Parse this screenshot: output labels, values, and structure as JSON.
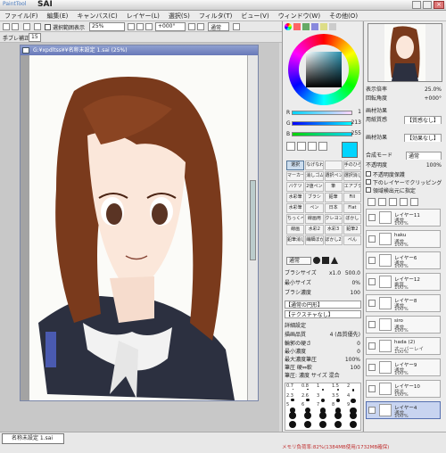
{
  "app": {
    "title": "SAI",
    "brand": "PaintTool"
  },
  "menu": [
    "ファイル(F)",
    "編集(E)",
    "キャンバス(C)",
    "レイヤー(L)",
    "選択(S)",
    "フィルタ(T)",
    "ビュー(V)",
    "ウィンドウ(W)",
    "その他(O)"
  ],
  "toolbar": {
    "selection_label": "選択範囲表示",
    "zoom": "25%",
    "rotation": "+000°",
    "mode": "通常",
    "stabilizer_label": "手ブレ補正",
    "stabilizer_value": "15"
  },
  "canvas": {
    "title": "G:¥xpdltss¥¥名称未設定 1.sai (25%)"
  },
  "bottom_tab": "名称未設定 1.sai",
  "status_text": "メモリ負荷率:82%(1384MB使用/1732MB確保)",
  "color": {
    "r": 1,
    "g": 213,
    "b": 255,
    "r_label": "R",
    "g_label": "G",
    "b_label": "B",
    "hex": "#01d5ff"
  },
  "tools": [
    "選択",
    "なげなわ",
    "",
    "手のひら",
    "マーカー",
    "消しゴム",
    "選択ペン",
    "選択消し",
    "バケツ",
    "2値ペン",
    "筆",
    "エアブラシ",
    "水彩筆",
    "ブラシ",
    "鉛筆",
    "Fill",
    "水彩筆",
    "ペン",
    "日本",
    "Flat",
    "ちっくぺ",
    "線画用",
    "クレヨン",
    "ぼかし",
    "線画",
    "水彩2",
    "水彩3",
    "鉛筆2",
    "鉛筆消し",
    "繊細ぼかし",
    "ぼかし2",
    "ぺん"
  ],
  "brush": {
    "mode": "通常",
    "size_label": "ブラシサイズ",
    "size_mult": "x1.0",
    "size_value": "500.0",
    "min_label": "最小サイズ",
    "min_value": "0%",
    "density_label": "ブラシ濃度",
    "density_value": "100",
    "shape_label": "【通常の円形】",
    "texture_label": "【テクスチャなし】",
    "detail_label": "詳細設定",
    "quality_label": "描画品質",
    "quality_value": "4 (品質優先)",
    "edge_label": "輪郭の硬さ",
    "edge_value": "0",
    "min_density_label": "最小濃度",
    "min_density_value": "0",
    "max_pressure_label": "最大濃度筆圧",
    "max_pressure_value": "100%",
    "pressure_label": "筆圧 硬⇔軟",
    "pressure_value": "100",
    "pressure2_label": "筆圧:",
    "pressure2_a": "濃度",
    "pressure2_b": "サイズ",
    "pressure2_c": "混合"
  },
  "brush_sizes": [
    [
      "0.7",
      "0.8",
      "1",
      "1.5",
      "2"
    ],
    [
      "2.3",
      "2.6",
      "3",
      "3.5",
      "4"
    ],
    [
      "5",
      "6",
      "7",
      "8",
      "9"
    ],
    [
      "10",
      "12",
      "14",
      "16",
      "20"
    ],
    [
      "25",
      "30",
      "35",
      "40",
      "50"
    ]
  ],
  "nav": {
    "zoom_label": "表示倍率",
    "zoom_value": "25.0%",
    "angle_label": "回転角度",
    "angle_value": "+000°",
    "paper_effect_label": "画材効果",
    "paper_texture_label": "用紙質感",
    "paper_texture_value": "【質感なし】",
    "paper_effect_value_label": "画材効果",
    "paper_effect_value": "【効果なし】",
    "blend_label": "合成モード",
    "blend_value": "通常",
    "opacity_label": "不透明度",
    "opacity_value": "100%",
    "protect_label": "不透明度保護",
    "clip_label": "下のレイヤーでクリッピング",
    "select_source_label": "領域検出元に指定"
  },
  "layers": [
    {
      "name": "レイヤー11",
      "mode": "通常",
      "opacity": "100%"
    },
    {
      "name": "haku",
      "mode": "通常",
      "opacity": "100%"
    },
    {
      "name": "レイヤー6",
      "mode": "通常",
      "opacity": "100%"
    },
    {
      "name": "レイヤー12",
      "mode": "乗算",
      "opacity": "100%"
    },
    {
      "name": "レイヤー8",
      "mode": "通常",
      "opacity": "100%"
    },
    {
      "name": "siro",
      "mode": "通常",
      "opacity": "100%"
    },
    {
      "name": "hada (2)",
      "mode": "オーバーレイ",
      "opacity": "100%"
    },
    {
      "name": "レイヤー9",
      "mode": "通常",
      "opacity": "100%"
    },
    {
      "name": "レイヤー10",
      "mode": "発光",
      "opacity": "100%"
    },
    {
      "name": "レイヤー4",
      "mode": "通常",
      "opacity": "100%"
    }
  ]
}
